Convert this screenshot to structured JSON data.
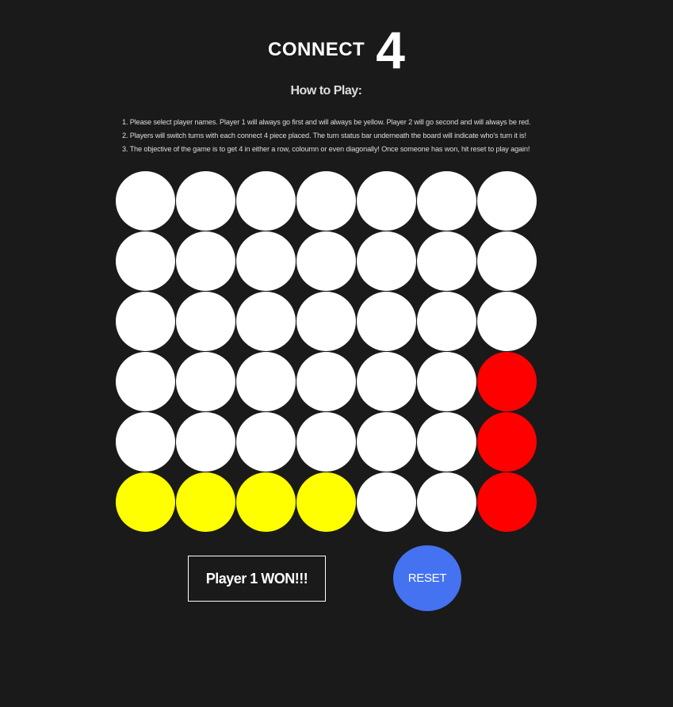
{
  "header": {
    "title_word": "CONNECT",
    "title_number": "4"
  },
  "how_to_play": {
    "title": "How to Play:",
    "steps": [
      "1. Please select player names. Player 1 will always go first and will always be yellow. Player 2 will go second and will always be red.",
      "2. Players will switch turns with each connect 4 piece placed. The turn status bar underneath the board will indicate who's turn it is!",
      "3. The objective of the game is to get 4 in either a row, coloumn or even diagonally! Once someone has won, hit reset to play again!"
    ]
  },
  "board": {
    "rows": 6,
    "columns": 7,
    "cells": [
      [
        "empty",
        "empty",
        "empty",
        "empty",
        "empty",
        "empty",
        "empty"
      ],
      [
        "empty",
        "empty",
        "empty",
        "empty",
        "empty",
        "empty",
        "empty"
      ],
      [
        "empty",
        "empty",
        "empty",
        "empty",
        "empty",
        "empty",
        "empty"
      ],
      [
        "empty",
        "empty",
        "empty",
        "empty",
        "empty",
        "empty",
        "red"
      ],
      [
        "empty",
        "empty",
        "empty",
        "empty",
        "empty",
        "empty",
        "red"
      ],
      [
        "yellow",
        "yellow",
        "yellow",
        "yellow",
        "empty",
        "empty",
        "red"
      ]
    ]
  },
  "colors": {
    "background": "#1a1a1a",
    "empty": "#ffffff",
    "player1": "#ffff00",
    "player2": "#ff0000",
    "reset_button": "#4472f0"
  },
  "status": {
    "text": "Player 1 WON!!!"
  },
  "controls": {
    "reset_label": "RESET"
  }
}
